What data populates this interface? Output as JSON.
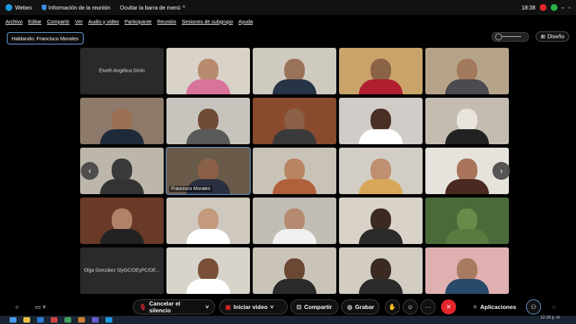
{
  "titlebar": {
    "app_name": "Webex",
    "meeting_info": "Información de la reunión",
    "hide_menu": "Ocultar la barra de menú",
    "time": "18:38",
    "minimize": "–",
    "restore": "▫"
  },
  "menu": [
    "Archivo",
    "Editar",
    "Compartir",
    "Ver",
    "Audio y video",
    "Participante",
    "Reunión",
    "Sesiones de subgrupo",
    "Ayuda"
  ],
  "speaking": "Hablando: Francisco Morales",
  "layout": {
    "design_label": "Diseño"
  },
  "tiles": [
    {
      "name": "Eiveth Angélica Girón",
      "center": true,
      "bg": "#2a2a2a"
    },
    {
      "name": "",
      "bg": "#d8d2c8",
      "head": "#b88a6e",
      "body": "#d8739a"
    },
    {
      "name": "",
      "bg": "#cfcac0",
      "head": "#9a7258",
      "body": "#263445"
    },
    {
      "name": "",
      "bg": "#c9a36a",
      "head": "#8a6246",
      "body": "#b02030"
    },
    {
      "name": "",
      "bg": "#b6a48a",
      "head": "#a27a5c",
      "body": "#4a4a50"
    },
    {
      "name": "",
      "bg": "#8d7a6a",
      "head": "#9c7054",
      "body": "#1e2a3a"
    },
    {
      "name": "",
      "bg": "#c8c4bd",
      "head": "#704c38",
      "body": "#5a5a5a"
    },
    {
      "name": "",
      "bg": "#8a4a2e",
      "head": "#8a6046",
      "body": "#3a3a3a"
    },
    {
      "name": "",
      "bg": "#d0ccc8",
      "head": "#4a3024",
      "body": "#ffffff"
    },
    {
      "name": "",
      "bg": "#c4bcb0",
      "head": "#e8e4dc",
      "body": "#222222"
    },
    {
      "name": "",
      "bg": "#bdb7ab",
      "head": "#3a3a3a",
      "body": "#333333"
    },
    {
      "name": "Francisco Morales",
      "active": true,
      "bg": "#6a5a4a",
      "head": "#8a6046",
      "body": "#2a3040"
    },
    {
      "name": "",
      "bg": "#c9c3b7",
      "head": "#b98462",
      "body": "#b0603a"
    },
    {
      "name": "",
      "bg": "#d2cec6",
      "head": "#c08e70",
      "body": "#d8a85a"
    },
    {
      "name": "",
      "bg": "#e6e2dc",
      "head": "#a8745a",
      "body": "#4a2a20"
    },
    {
      "name": "",
      "bg": "#6a3a28",
      "head": "#b08268",
      "body": "#222222"
    },
    {
      "name": "",
      "bg": "#cec8be",
      "head": "#c49a7e",
      "body": "#ffffff"
    },
    {
      "name": "",
      "bg": "#c2bdb4",
      "head": "#b48a70",
      "body": "#f0f0f0"
    },
    {
      "name": "",
      "bg": "#d8d2c8",
      "head": "#3a2a22",
      "body": "#2a2a2a"
    },
    {
      "name": "",
      "bg": "#4a6a3a",
      "head": "#6a8a4a",
      "body": "#5a7a40"
    },
    {
      "name": "Olga González SlyGC/DEyPC/DE...",
      "center": true,
      "bg": "#2a2a2a"
    },
    {
      "name": "",
      "bg": "#d8d4cc",
      "head": "#7a5038",
      "body": "#ffffff"
    },
    {
      "name": "",
      "bg": "#cac4b8",
      "head": "#6a4834",
      "body": "#2a2a2a"
    },
    {
      "name": "",
      "bg": "#d2ccc2",
      "head": "#3a2a22",
      "body": "#2a2a2a"
    },
    {
      "name": "",
      "bg": "#e0b0b0",
      "head": "#a87a60",
      "body": "#2a4a6a"
    }
  ],
  "toolbar": {
    "mute_label": "Cancelar el silencio",
    "video_label": "Iniciar video",
    "share_label": "Compartir",
    "record_label": "Grabar",
    "apps_label": "Aplicaciones",
    "end_label": "✕"
  },
  "taskbar": {
    "clock": "12:16 p. m."
  },
  "colors": {
    "accent": "#6aa7e6",
    "end": "#e3262c",
    "mute_icon": "#e3262c"
  }
}
